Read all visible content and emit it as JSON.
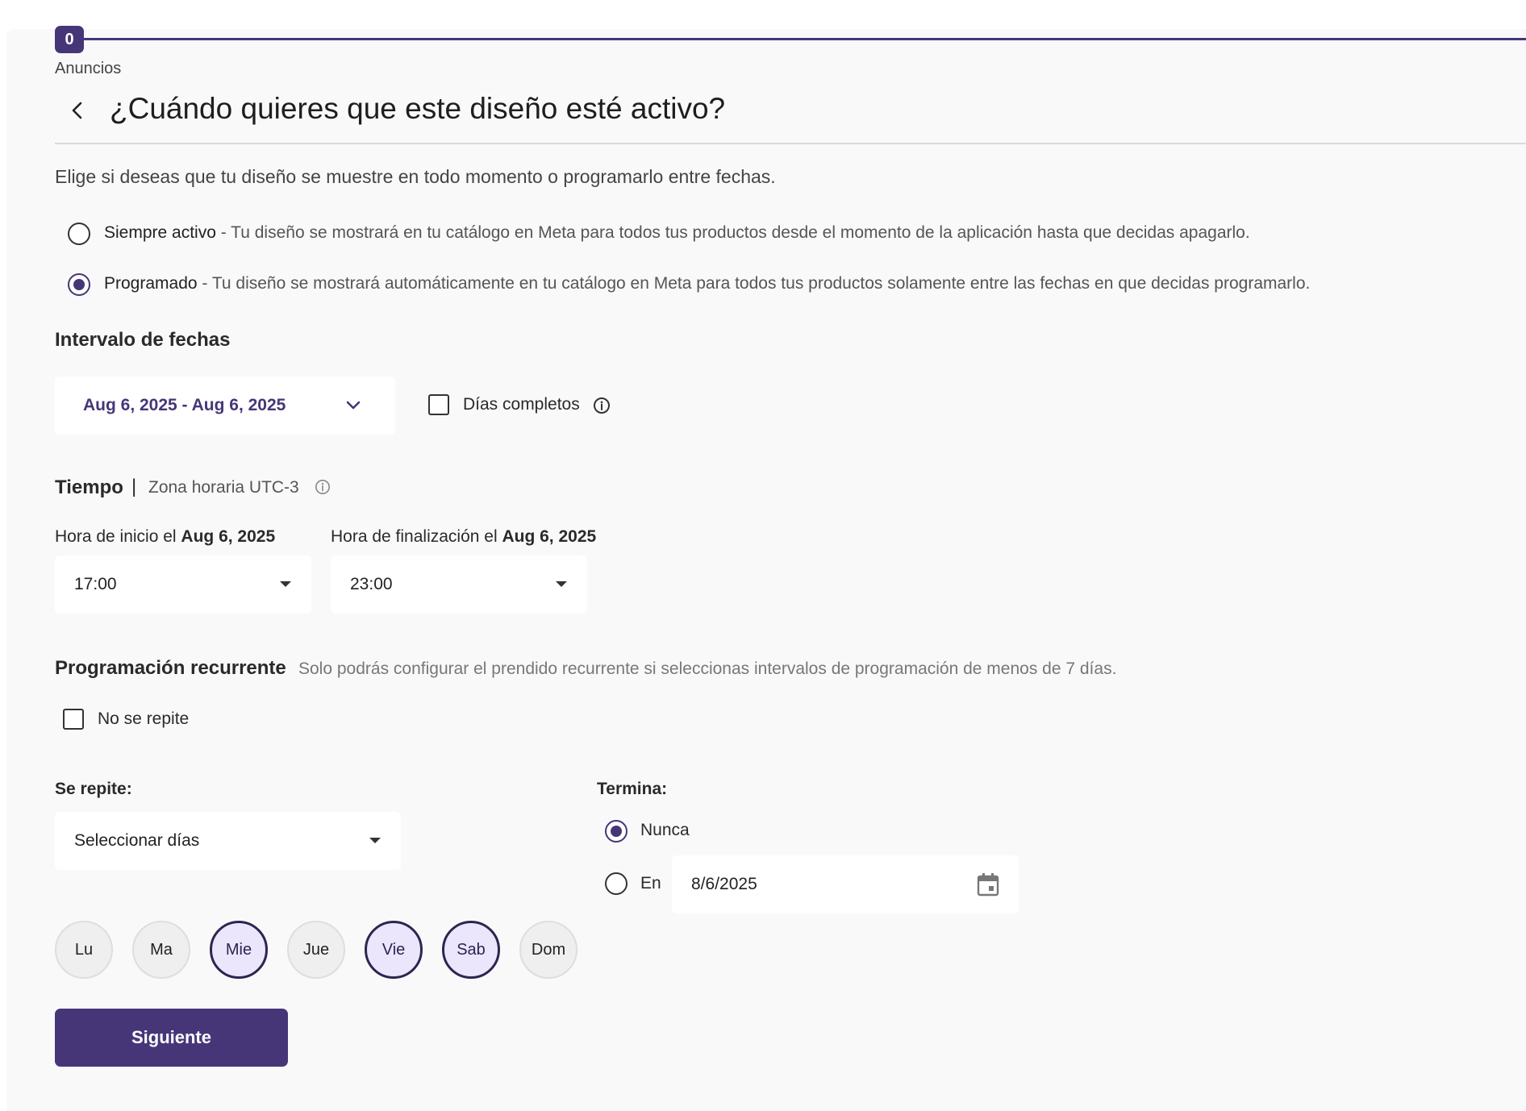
{
  "stepper": {
    "number": "0",
    "label": "Anuncios"
  },
  "header": {
    "title": "¿Cuándo quieres que este diseño esté activo?"
  },
  "subtitle": "Elige si deseas que tu diseño se muestre en todo momento o programarlo entre fechas.",
  "options": {
    "always": {
      "label": "Siempre activo",
      "description": " - Tu diseño se mostrará en tu catálogo en Meta para todos tus productos desde el momento de la aplicación hasta que decidas apagarlo.",
      "selected": false
    },
    "scheduled": {
      "label": "Programado",
      "description": " - Tu diseño se mostrará automáticamente en tu catálogo en Meta para todos tus productos solamente entre las fechas en que decidas programarlo.",
      "selected": true
    }
  },
  "date_interval": {
    "title": "Intervalo de fechas",
    "range": "Aug 6, 2025 - Aug 6, 2025",
    "full_days_label": "Días completos",
    "full_days_checked": false
  },
  "time": {
    "title": "Tiempo",
    "separator": "|",
    "timezone": "Zona horaria UTC-3",
    "start_label": "Hora de inicio el ",
    "start_date": "Aug 6, 2025",
    "start_value": "17:00",
    "end_label": "Hora de finalización el ",
    "end_date": "Aug 6, 2025",
    "end_value": "23:00"
  },
  "recurring": {
    "title": "Programación recurrente",
    "note": "Solo podrás configurar el prendido recurrente si seleccionas intervalos de programación de menos de 7 días.",
    "no_repeat_label": "No se repite",
    "no_repeat_checked": false,
    "repeats_label": "Se repite:",
    "repeats_value": "Seleccionar días",
    "ends_label": "Termina:",
    "ends_never": "Nunca",
    "ends_on": "En",
    "ends_on_date": "8/6/2025",
    "ends_selected": "never"
  },
  "days": [
    {
      "label": "Lu",
      "selected": false
    },
    {
      "label": "Ma",
      "selected": false
    },
    {
      "label": "Mie",
      "selected": true
    },
    {
      "label": "Jue",
      "selected": false
    },
    {
      "label": "Vie",
      "selected": true
    },
    {
      "label": "Sab",
      "selected": true
    },
    {
      "label": "Dom",
      "selected": false
    }
  ],
  "actions": {
    "next": "Siguiente"
  },
  "colors": {
    "brand": "#463678",
    "selected_day_bg": "#ebe6fc",
    "panel_bg": "#f9f9f9"
  }
}
